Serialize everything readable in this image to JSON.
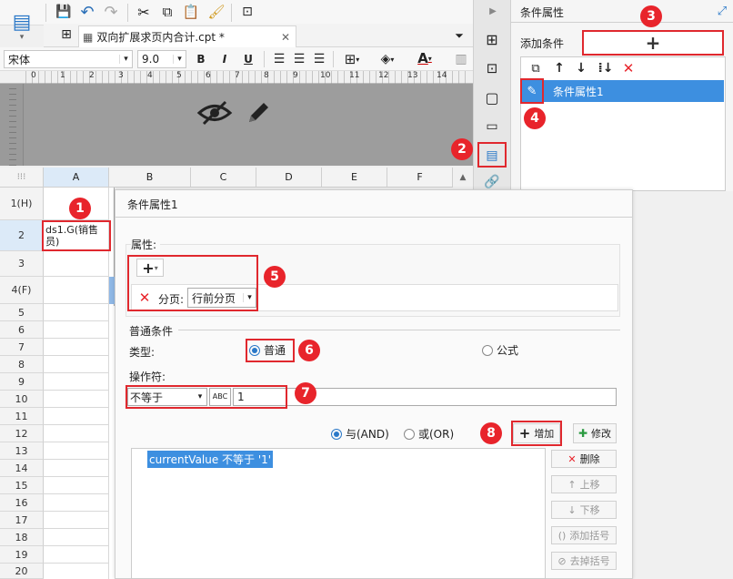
{
  "toolbar": {
    "tab_label": "双向扩展求页内合计.cpt *",
    "font_name": "宋体",
    "font_size": "9.0"
  },
  "ruler": {
    "zero": "0",
    "ticks": [
      "1",
      "2",
      "3",
      "4",
      "5",
      "6",
      "7",
      "8",
      "9",
      "10",
      "11",
      "12",
      "13",
      "14"
    ]
  },
  "grid": {
    "columns": [
      "A",
      "B",
      "C",
      "D",
      "E",
      "F"
    ],
    "rows": [
      "1(H)",
      "2",
      "3",
      "4(F)",
      "5",
      "6",
      "7",
      "8",
      "9",
      "10",
      "11",
      "12",
      "13",
      "14",
      "15",
      "16",
      "17",
      "18",
      "19",
      "20"
    ],
    "cell_a2": "ds1.G(销售员)"
  },
  "right_panel": {
    "title": "条件属性",
    "add_label": "添加条件",
    "add_symbol": "+",
    "item_label": "条件属性1"
  },
  "dialog": {
    "title": "条件属性1",
    "attr_section": "属性:",
    "page_label": "分页:",
    "page_value": "行前分页",
    "normal_section": "普通条件",
    "type_label": "类型:",
    "type_normal": "普通",
    "type_formula": "公式",
    "operator_label": "操作符:",
    "operator_value": "不等于",
    "value": "1",
    "and_label": "与(AND)",
    "or_label": "或(OR)",
    "add_btn": "增加",
    "edit_btn": "修改",
    "delete_btn": "删除",
    "up_btn": "上移",
    "down_btn": "下移",
    "add_bracket": "添加括号",
    "remove_bracket": "去掉括号",
    "condition": "currentValue 不等于 '1'"
  },
  "badges": [
    "1",
    "2",
    "3",
    "4",
    "5",
    "6",
    "7",
    "8"
  ],
  "colors": {
    "accent": "#3a8ee6",
    "red": "#e8242b",
    "selection": "#3d8fe0"
  }
}
